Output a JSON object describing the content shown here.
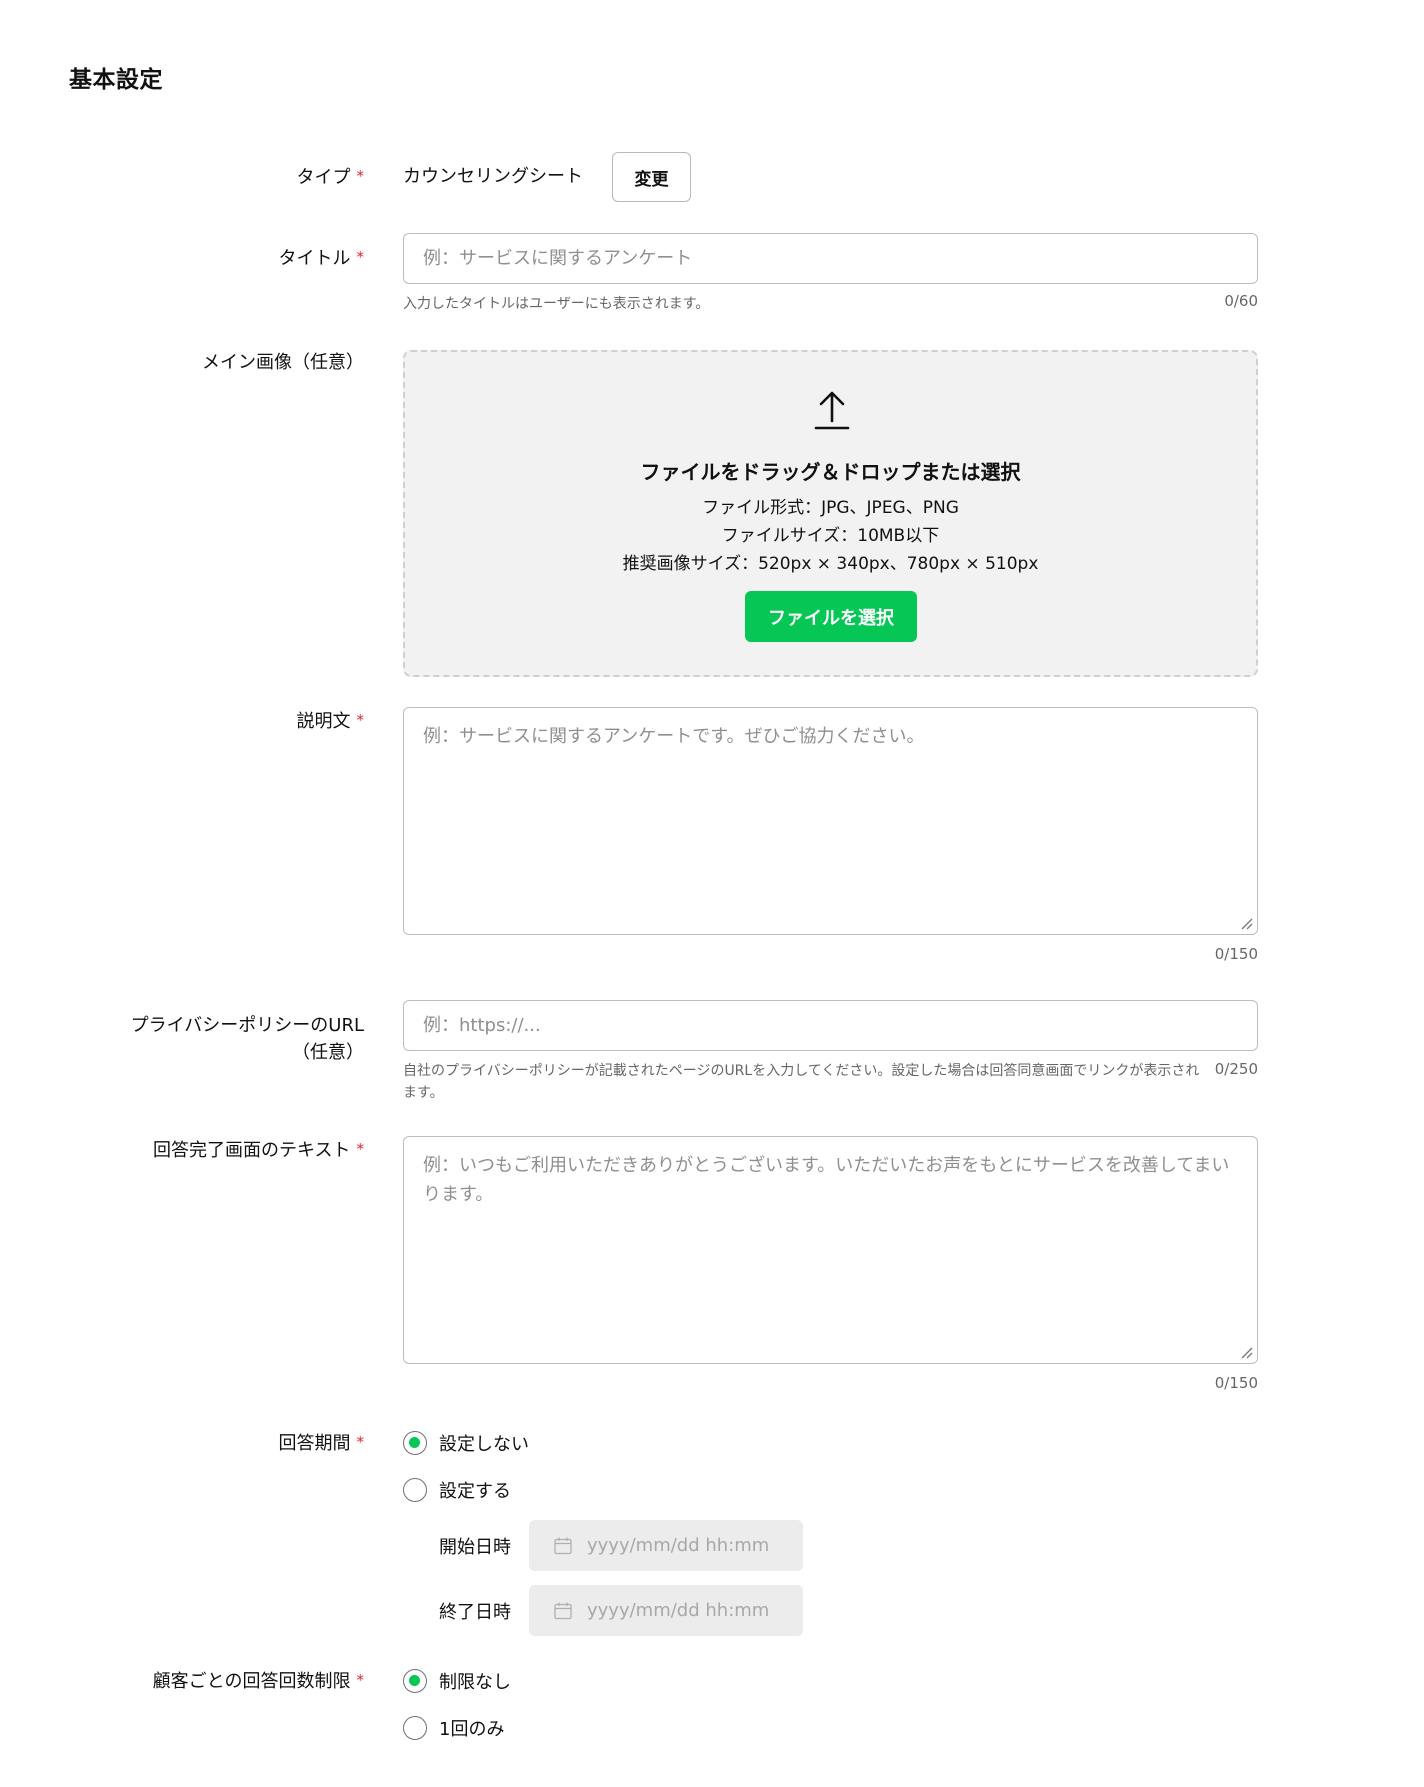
{
  "section_title": "基本設定",
  "fields": {
    "type": {
      "label": "タイプ",
      "required_mark": "*",
      "value": "カウンセリングシート",
      "change_label": "変更"
    },
    "title": {
      "label": "タイトル",
      "required_mark": "*",
      "placeholder": "例：サービスに関するアンケート",
      "help": "入力したタイトルはユーザーにも表示されます。",
      "counter": "0/60"
    },
    "main_image": {
      "label": "メイン画像（任意）",
      "drop_title": "ファイルをドラッグ＆ドロップまたは選択",
      "format": "ファイル形式：JPG、JPEG、PNG",
      "size": "ファイルサイズ：10MB以下",
      "recommended": "推奨画像サイズ：520px × 340px、780px × 510px",
      "select_label": "ファイルを選択"
    },
    "description": {
      "label": "説明文",
      "required_mark": "*",
      "placeholder": "例：サービスに関するアンケートです。ぜひご協力ください。",
      "counter": "0/150"
    },
    "privacy_url": {
      "label_line1": "プライバシーポリシーのURL",
      "label_line2": "（任意）",
      "placeholder": "例：https://...",
      "help": "自社のプライバシーポリシーが記載されたページのURLを入力してください。設定した場合は回答同意画面でリンクが表示されます。",
      "counter": "0/250"
    },
    "completion_text": {
      "label": "回答完了画面のテキスト",
      "required_mark": "*",
      "placeholder": "例：いつもご利用いただきありがとうございます。いただいたお声をもとにサービスを改善してまいります。",
      "counter": "0/150"
    },
    "answer_period": {
      "label": "回答期間",
      "required_mark": "*",
      "options": [
        "設定しない",
        "設定する"
      ],
      "selected": "設定しない",
      "start_label": "開始日時",
      "end_label": "終了日時",
      "date_placeholder": "yyyy/mm/dd hh:mm"
    },
    "answer_limit": {
      "label": "顧客ごとの回答回数制限",
      "required_mark": "*",
      "options": [
        "制限なし",
        "1回のみ"
      ],
      "selected": "制限なし"
    }
  },
  "colors": {
    "accent": "#06c755",
    "required": "#e0232e",
    "border": "#bdbdbd",
    "dropzone_bg": "#f2f2f2"
  },
  "icons": {
    "upload": "upload-arrow-icon",
    "calendar": "calendar-icon",
    "resize": "resize-handle-icon"
  }
}
